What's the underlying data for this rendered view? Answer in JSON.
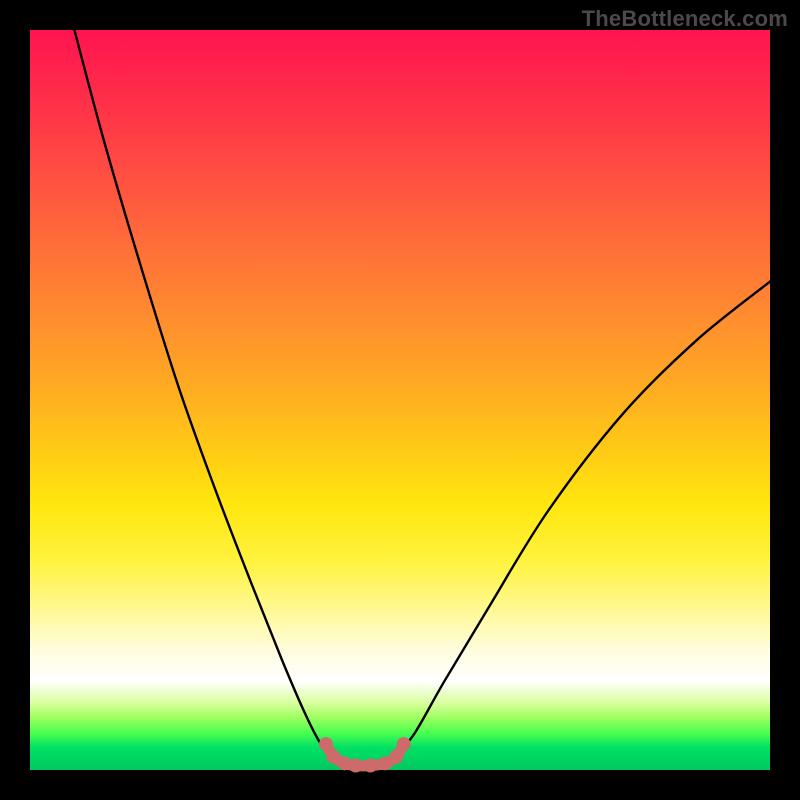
{
  "watermark": "TheBottleneck.com",
  "chart_data": {
    "type": "line",
    "title": "",
    "xlabel": "",
    "ylabel": "",
    "xlim": [
      0,
      100
    ],
    "ylim": [
      0,
      100
    ],
    "gradient_background": {
      "direction": "vertical",
      "stops": [
        {
          "pos": 0,
          "color": "#ff1450"
        },
        {
          "pos": 50,
          "color": "#ffbb18"
        },
        {
          "pos": 70,
          "color": "#fff340"
        },
        {
          "pos": 88,
          "color": "#ffffff"
        },
        {
          "pos": 100,
          "color": "#00c860"
        }
      ]
    },
    "series": [
      {
        "name": "left-branch",
        "color": "#000000",
        "x": [
          6,
          10,
          15,
          20,
          25,
          30,
          34,
          37,
          39,
          40.5
        ],
        "y": [
          100,
          85,
          68,
          52,
          38,
          25,
          15,
          8,
          4,
          2
        ]
      },
      {
        "name": "right-branch",
        "color": "#000000",
        "x": [
          49.5,
          52,
          56,
          62,
          70,
          80,
          90,
          100
        ],
        "y": [
          2,
          5,
          12,
          22,
          35,
          48,
          58,
          66
        ]
      },
      {
        "name": "bottom-u-highlight",
        "color": "#cc6b69",
        "thick": true,
        "x": [
          40,
          41,
          42.5,
          44,
          46,
          48,
          49.5,
          50.5
        ],
        "y": [
          3.5,
          1.8,
          0.9,
          0.6,
          0.6,
          0.9,
          1.8,
          3.5
        ]
      }
    ],
    "markers": {
      "color": "#cc6b69",
      "points": [
        {
          "x": 40,
          "y": 3.5
        },
        {
          "x": 41,
          "y": 1.8
        },
        {
          "x": 42.5,
          "y": 0.9
        },
        {
          "x": 44,
          "y": 0.6
        },
        {
          "x": 46,
          "y": 0.6
        },
        {
          "x": 48,
          "y": 0.9
        },
        {
          "x": 49.5,
          "y": 1.8
        },
        {
          "x": 50.5,
          "y": 3.5
        }
      ]
    }
  }
}
